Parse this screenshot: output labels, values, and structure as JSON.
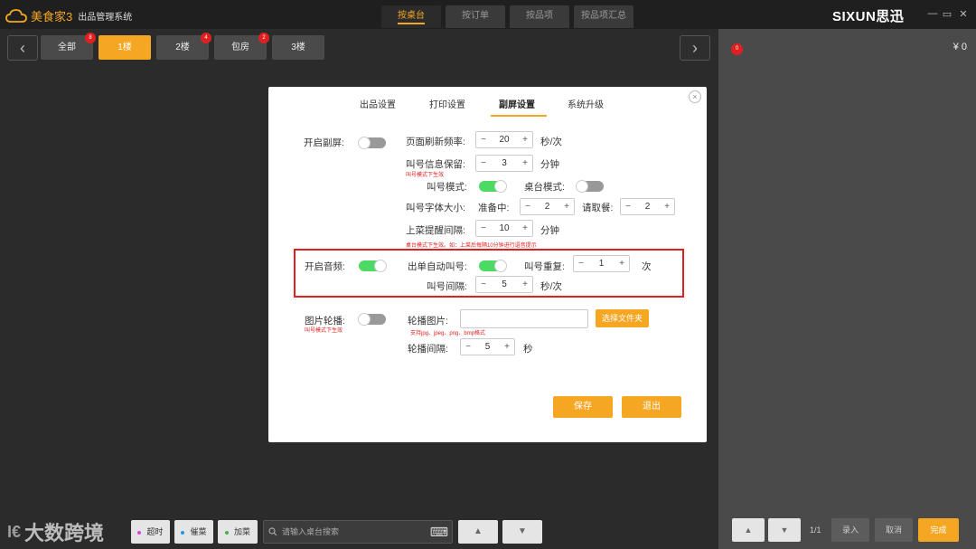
{
  "app": {
    "logo_text": "美食家3",
    "system_name": "出品管理系统",
    "brand": "SIXUN思迅",
    "tabs": [
      "按桌台",
      "按订单",
      "按品项",
      "按品项汇总"
    ],
    "window_controls": [
      "—",
      "▭",
      "✕"
    ]
  },
  "floors": {
    "tabs": [
      {
        "label": "全部",
        "badge": "8"
      },
      {
        "label": "1楼",
        "badge": ""
      },
      {
        "label": "2楼",
        "badge": "4"
      },
      {
        "label": "包房",
        "badge": "2"
      },
      {
        "label": "3楼",
        "badge": ""
      }
    ],
    "prev_icon": "‹",
    "next_icon": "›"
  },
  "right_panel": {
    "badge": "0",
    "total": "¥  0",
    "page": "1/1",
    "buttons": [
      "录入",
      "取消",
      "完成"
    ]
  },
  "bottom": {
    "buttons": [
      {
        "label": "超时",
        "color": "#e040e0"
      },
      {
        "label": "催菜",
        "color": "#2196f3"
      },
      {
        "label": "加菜",
        "color": "#4caf50"
      }
    ],
    "search_placeholder": "请输入桌台搜索",
    "keyboard_icon": "⌨",
    "up_icon": "▲",
    "down_icon": "▼"
  },
  "watermark": {
    "text": "大数跨境",
    "icon_text": "I€"
  },
  "modal": {
    "tabs": [
      "出品设置",
      "打印设置",
      "副屏设置",
      "系统升级"
    ],
    "active_tab": 2,
    "close_icon": "×",
    "enable_screen": {
      "label": "开启副屏:",
      "on": false
    },
    "refresh": {
      "label": "页面刷新频率:",
      "value": "20",
      "unit": "秒/次"
    },
    "retain": {
      "label": "叫号信息保留:",
      "value": "3",
      "unit": "分钟",
      "note": "叫号模式下生效"
    },
    "call_mode": {
      "label": "叫号模式:",
      "on": true
    },
    "table_mode": {
      "label": "桌台模式:",
      "on": false
    },
    "font_size": {
      "label": "叫号字体大小:",
      "preparing_label": "准备中:",
      "preparing_value": "2",
      "pickup_label": "请取餐:",
      "pickup_value": "2"
    },
    "serve_interval": {
      "label": "上菜提醒间隔:",
      "value": "10",
      "unit": "分钟",
      "note": "桌台模式下生效。如：上菜后每隔10分钟进行语音提示"
    },
    "audio": {
      "label": "开启音频:",
      "on": true
    },
    "auto_call": {
      "label": "出单自动叫号:",
      "on": true
    },
    "repeat": {
      "label": "叫号重复:",
      "value": "1",
      "unit": "次"
    },
    "call_interval": {
      "label": "叫号间隔:",
      "value": "5",
      "unit": "秒/次"
    },
    "carousel": {
      "label": "图片轮播:",
      "on": false,
      "note": "叫号模式下生效"
    },
    "carousel_image": {
      "label": "轮播图片:",
      "value": "",
      "button": "选择文件夹",
      "note": "支持jpg、jpeg、png、bmp格式"
    },
    "carousel_interval": {
      "label": "轮播间隔:",
      "value": "5",
      "unit": "秒"
    },
    "save": "保存",
    "exit": "退出",
    "minus": "−",
    "plus": "+"
  }
}
